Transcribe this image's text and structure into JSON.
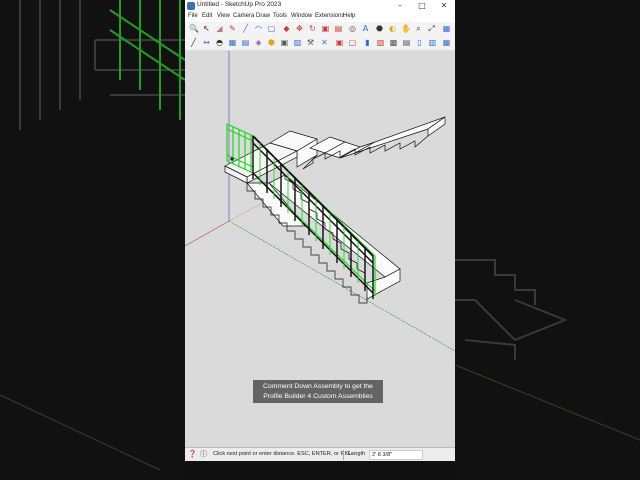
{
  "window": {
    "title": "Untitled - SketchUp Pro 2023",
    "controls": [
      "–",
      "□",
      "✕"
    ]
  },
  "menubar": {
    "items": [
      "File",
      "Edit",
      "View",
      "Camera",
      "Draw",
      "Tools",
      "Window",
      "Extensions",
      "Help"
    ]
  },
  "toolbar": {
    "row1_icons": [
      "select-icon",
      "eraser-icon",
      "pencil-icon",
      "line-icon",
      "rectangle-icon",
      "push-pull-icon",
      "move-icon",
      "rotate-icon",
      "scale-icon",
      "offset-icon",
      "tape-measure-icon",
      "text-icon",
      "paint-bucket-icon",
      "orbit-icon",
      "pan-icon",
      "zoom-icon",
      "zoom-extents-icon",
      "undo-icon",
      "redo-icon",
      "layout-icon"
    ],
    "row2_icons": [
      "section-icon",
      "dimension-icon",
      "protractor-icon",
      "axes-icon",
      "warehouse-icon",
      "extension-icon",
      "component-icon",
      "group-icon",
      "styles-icon",
      "tags-icon",
      "scenes-icon",
      "shadows-icon",
      "fog-icon",
      "match-photo-icon",
      "profile-builder-icon",
      "export-icon",
      "import-icon",
      "outliner-icon",
      "entity-info-icon",
      "materials-icon"
    ],
    "accent_colors": [
      "#2f6fd0",
      "#d03a2f",
      "#e1a419",
      "#3aa03a",
      "#8a4fc0"
    ]
  },
  "caption": {
    "line1": "Comment Down Assembly to get the",
    "line2": "Profile Builder 4 Custom Assemblies"
  },
  "statusbar": {
    "hint": "Click next point or enter distance. ESC, ENTER, or RIG...",
    "measurement_label": "Length",
    "measurement_value": "2' 8 3/8\""
  },
  "colors": {
    "viewport_bg": "#dadada",
    "railing_selected": "#1fd81f",
    "railing_edges": "#0a0a0a",
    "axis_red": "#c84a4a",
    "axis_green": "#3aa03a",
    "axis_blue": "#5a5ad0"
  }
}
